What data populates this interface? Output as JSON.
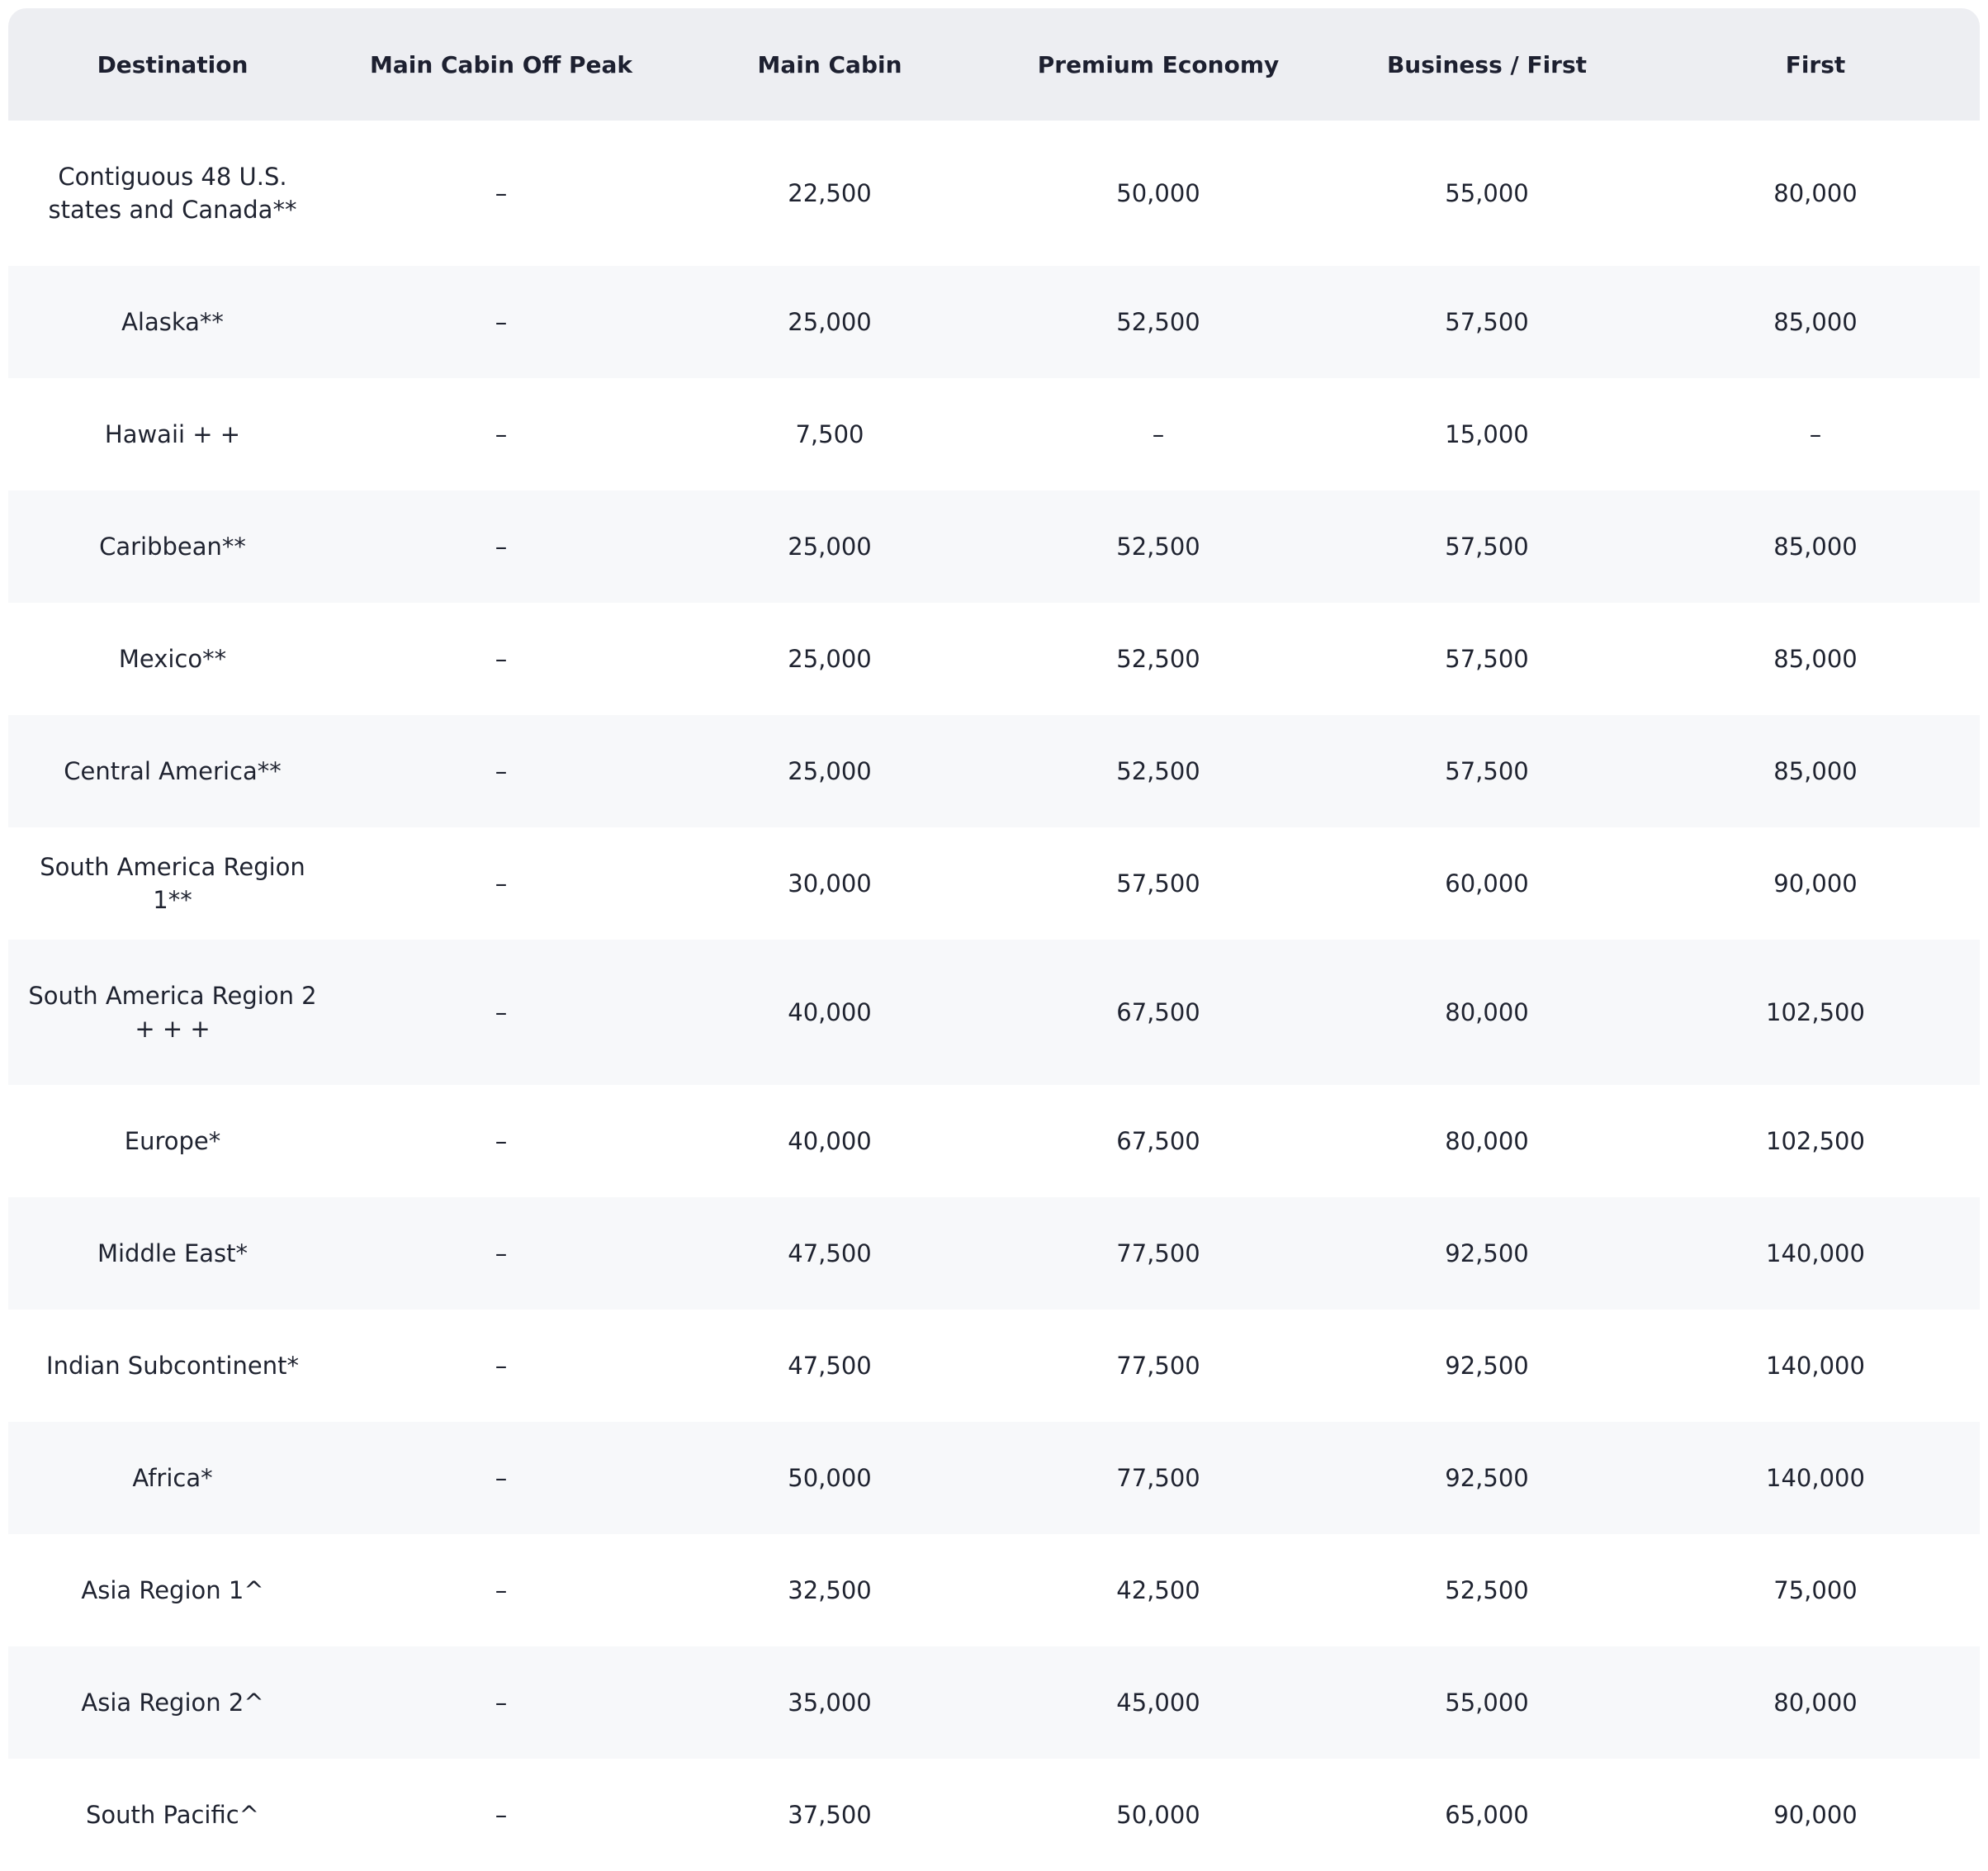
{
  "table": {
    "columns": [
      "Destination",
      "Main Cabin Off Peak",
      "Main Cabin",
      "Premium Economy",
      "Business / First",
      "First"
    ],
    "rows": [
      {
        "destination": "Contiguous 48 U.S. states and Canada**",
        "off_peak": "–",
        "main_cabin": "22,500",
        "premium_economy": "50,000",
        "business_first": "55,000",
        "first": "80,000"
      },
      {
        "destination": "Alaska**",
        "off_peak": "–",
        "main_cabin": "25,000",
        "premium_economy": "52,500",
        "business_first": "57,500",
        "first": "85,000"
      },
      {
        "destination": "Hawaii + +",
        "off_peak": "–",
        "main_cabin": "7,500",
        "premium_economy": "–",
        "business_first": "15,000",
        "first": "–"
      },
      {
        "destination": "Caribbean**",
        "off_peak": "–",
        "main_cabin": "25,000",
        "premium_economy": "52,500",
        "business_first": "57,500",
        "first": "85,000"
      },
      {
        "destination": "Mexico**",
        "off_peak": "–",
        "main_cabin": "25,000",
        "premium_economy": "52,500",
        "business_first": "57,500",
        "first": "85,000"
      },
      {
        "destination": "Central America**",
        "off_peak": "–",
        "main_cabin": "25,000",
        "premium_economy": "52,500",
        "business_first": "57,500",
        "first": "85,000"
      },
      {
        "destination": "South America Region 1**",
        "off_peak": "–",
        "main_cabin": "30,000",
        "premium_economy": "57,500",
        "business_first": "60,000",
        "first": "90,000"
      },
      {
        "destination": "South America Region 2 + + +",
        "off_peak": "–",
        "main_cabin": "40,000",
        "premium_economy": "67,500",
        "business_first": "80,000",
        "first": "102,500"
      },
      {
        "destination": "Europe*",
        "off_peak": "–",
        "main_cabin": "40,000",
        "premium_economy": "67,500",
        "business_first": "80,000",
        "first": "102,500"
      },
      {
        "destination": "Middle East*",
        "off_peak": "–",
        "main_cabin": "47,500",
        "premium_economy": "77,500",
        "business_first": "92,500",
        "first": "140,000"
      },
      {
        "destination": "Indian Subcontinent*",
        "off_peak": "–",
        "main_cabin": "47,500",
        "premium_economy": "77,500",
        "business_first": "92,500",
        "first": "140,000"
      },
      {
        "destination": "Africa*",
        "off_peak": "–",
        "main_cabin": "50,000",
        "premium_economy": "77,500",
        "business_first": "92,500",
        "first": "140,000"
      },
      {
        "destination": "Asia Region 1^",
        "off_peak": "–",
        "main_cabin": "32,500",
        "premium_economy": "42,500",
        "business_first": "52,500",
        "first": "75,000"
      },
      {
        "destination": "Asia Region 2^",
        "off_peak": "–",
        "main_cabin": "35,000",
        "premium_economy": "45,000",
        "business_first": "55,000",
        "first": "80,000"
      },
      {
        "destination": "South Pacific^",
        "off_peak": "–",
        "main_cabin": "37,500",
        "premium_economy": "50,000",
        "business_first": "65,000",
        "first": "90,000"
      }
    ]
  }
}
